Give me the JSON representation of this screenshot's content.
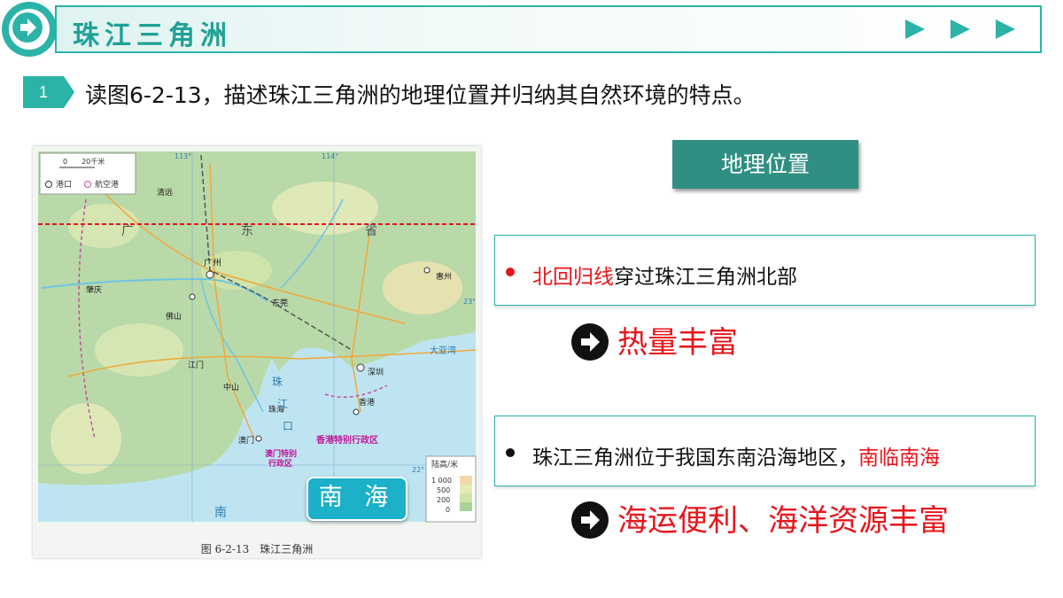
{
  "header": {
    "title": "珠江三角洲"
  },
  "question": {
    "number": "1",
    "text": "读图6-2-13，描述珠江三角洲的地理位置并归纳其自然环境的特点。"
  },
  "map": {
    "caption": "图 6-2-13　珠江三角洲",
    "scale": "0　　20千米",
    "legend_port": "港口",
    "legend_airport": "航空港",
    "elevation_title": "陆高/米",
    "elevation_levels": [
      "1 000",
      "500",
      "200",
      "0"
    ],
    "sea_label": "南 海",
    "labels": {
      "guangdong": "广",
      "dong": "东",
      "sheng": "省",
      "guangzhou": "广州",
      "shenzhen": "深圳",
      "dongguan": "东莞",
      "zhuhai": "珠海",
      "aomen": "澳门",
      "xianggang": "香港",
      "foshan": "佛山",
      "zhongshan": "中山",
      "jiangmen": "江门",
      "huizhou": "惠州",
      "zhaoqing": "肇庆",
      "qingyuan": "清远",
      "hk_region": "香港特别行政区",
      "macau_region1": "澳门特别",
      "macau_region2": "行政区",
      "zhujiang_kou1": "珠",
      "zhujiang_kou2": "江",
      "zhujiang_kou3": "口",
      "nan": "南",
      "dayawan": "大亚湾",
      "lon113": "113°",
      "lon114": "114°",
      "lat23": "23°",
      "lat22": "22°"
    },
    "colors": {
      "land": "#b9d9a9",
      "sea": "#bfe4f1",
      "tropic": "#e8141b"
    }
  },
  "geo_button": "地理位置",
  "point1": {
    "highlight": "北回归线",
    "rest": "穿过珠江三角洲北部",
    "bullet_color": "#e8141b"
  },
  "result1": "热量丰富",
  "point2": {
    "text": "珠江三角洲位于我国东南沿海地区，",
    "highlight": "南临南海",
    "bullet_color": "#111111"
  },
  "result2": "海运便利、海洋资源丰富"
}
